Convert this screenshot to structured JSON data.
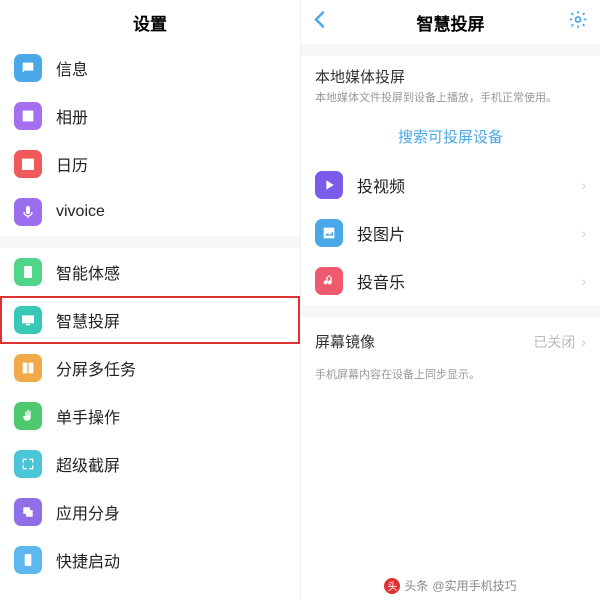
{
  "left": {
    "title": "设置",
    "groups": [
      [
        {
          "icon": "message-icon",
          "bg": "bg-blue",
          "label": "信息"
        },
        {
          "icon": "photos-icon",
          "bg": "bg-purple",
          "label": "相册"
        },
        {
          "icon": "calendar-icon",
          "bg": "bg-red",
          "label": "日历"
        },
        {
          "icon": "mic-icon",
          "bg": "bg-violet",
          "label": "vivoice"
        }
      ],
      [
        {
          "icon": "motion-icon",
          "bg": "bg-green",
          "label": "智能体感"
        },
        {
          "icon": "cast-icon",
          "bg": "bg-teal",
          "label": "智慧投屏",
          "highlight": true
        },
        {
          "icon": "split-icon",
          "bg": "bg-orange",
          "label": "分屏多任务"
        },
        {
          "icon": "hand-icon",
          "bg": "bg-greendp",
          "label": "单手操作"
        },
        {
          "icon": "screenshot-icon",
          "bg": "bg-cyan",
          "label": "超级截屏"
        },
        {
          "icon": "clone-icon",
          "bg": "bg-purpledp",
          "label": "应用分身"
        },
        {
          "icon": "launch-icon",
          "bg": "bg-skysq",
          "label": "快捷启动"
        }
      ]
    ]
  },
  "right": {
    "title": "智慧投屏",
    "local": {
      "title": "本地媒体投屏",
      "desc": "本地媒体文件投屏到设备上播放，手机正常使用。",
      "search": "搜索可投屏设备",
      "items": [
        {
          "icon": "play-icon",
          "bg": "bg-playpurple",
          "label": "投视频"
        },
        {
          "icon": "image-icon",
          "bg": "bg-picblue",
          "label": "投图片"
        },
        {
          "icon": "music-icon",
          "bg": "bg-musicred",
          "label": "投音乐"
        }
      ]
    },
    "mirror": {
      "label": "屏幕镜像",
      "status": "已关闭",
      "desc": "手机屏幕内容在设备上同步显示。"
    }
  },
  "footer": {
    "prefix": "头条",
    "author": "@实用手机技巧"
  }
}
